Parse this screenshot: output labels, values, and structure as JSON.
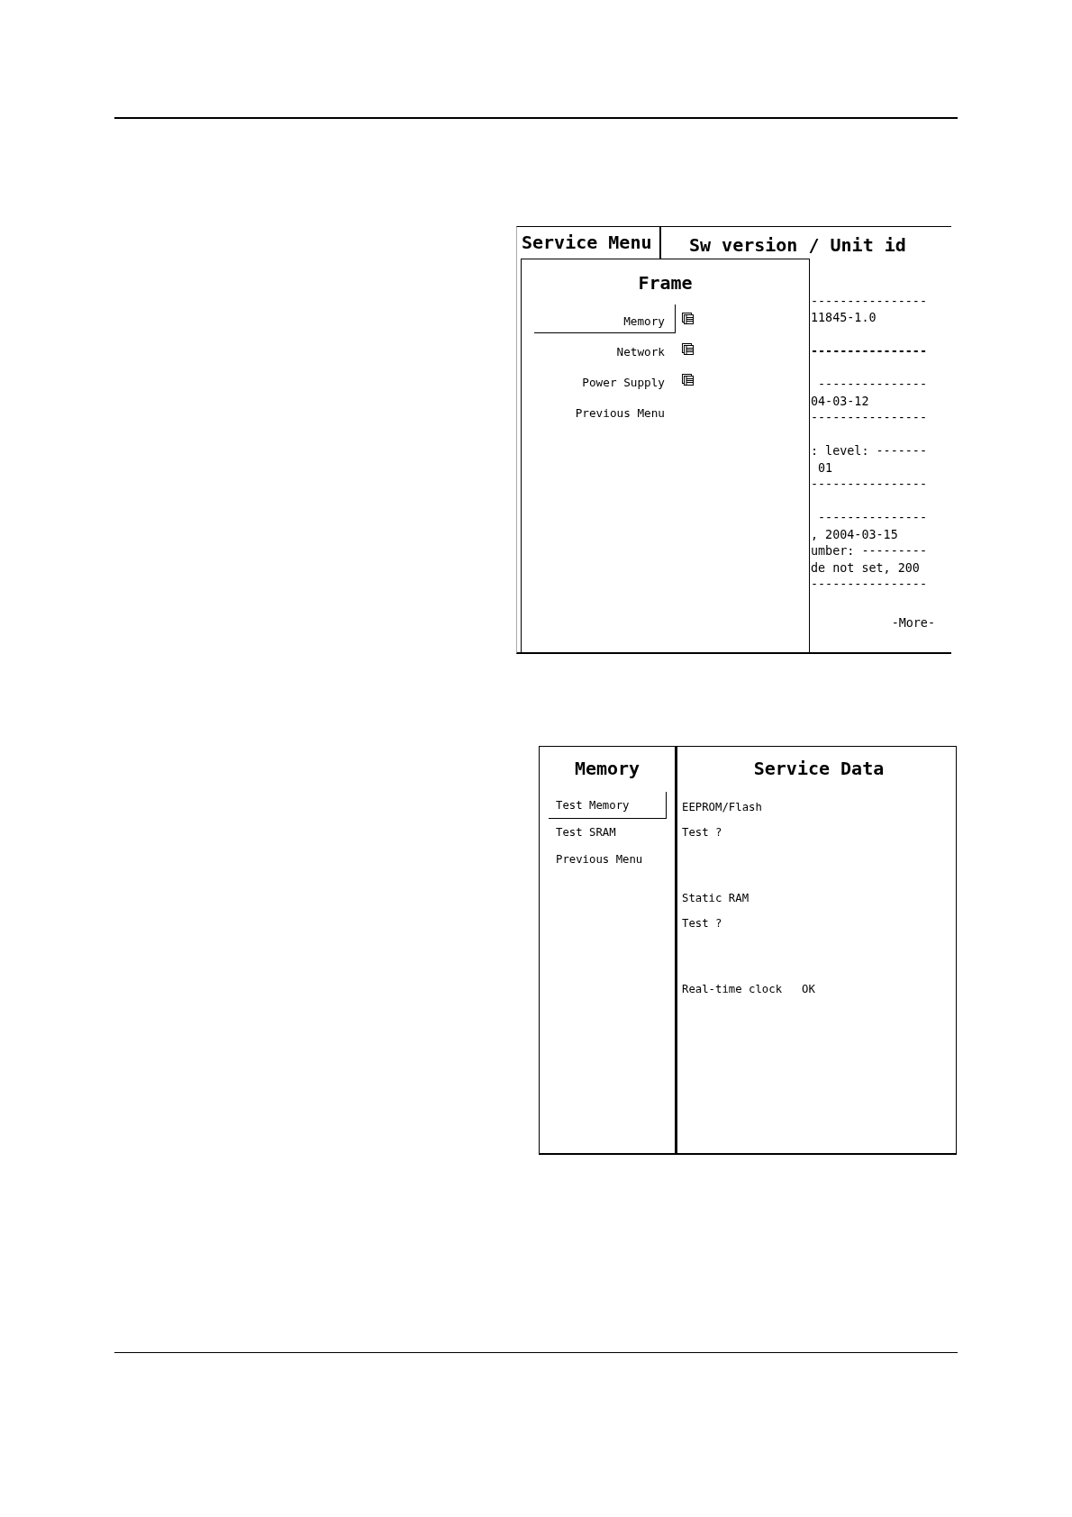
{
  "top_screen": {
    "menu_title": "Service Menu",
    "window_title": "Sw version / Unit id",
    "popup": {
      "title": "Frame",
      "items": [
        {
          "label": "Memory",
          "selected": true,
          "has_submenu": true
        },
        {
          "label": "Network",
          "selected": false,
          "has_submenu": true
        },
        {
          "label": "Power Supply",
          "selected": false,
          "has_submenu": true
        },
        {
          "label": "Previous Menu",
          "selected": false,
          "has_submenu": false
        }
      ]
    },
    "info_groups": [
      {
        "lines": [
          {
            "text": "----------------",
            "bold": false
          },
          {
            "text": "11845-1.0",
            "bold": false
          }
        ]
      },
      {
        "lines": [
          {
            "text": "----------------",
            "bold": true
          }
        ]
      },
      {
        "lines": [
          {
            "text": " ---------------",
            "bold": false
          },
          {
            "text": "04-03-12",
            "bold": false
          },
          {
            "text": "----------------",
            "bold": false
          }
        ]
      },
      {
        "lines": [
          {
            "text": ": level: -------",
            "bold": false
          },
          {
            "text": " 01",
            "bold": false
          },
          {
            "text": "----------------",
            "bold": false
          }
        ]
      },
      {
        "lines": [
          {
            "text": " ---------------",
            "bold": false
          },
          {
            "text": ", 2004-03-15",
            "bold": false
          },
          {
            "text": "umber: ---------",
            "bold": false
          },
          {
            "text": "de not set, 200",
            "bold": false
          },
          {
            "text": "----------------",
            "bold": false
          }
        ]
      }
    ],
    "more": "-More-"
  },
  "bottom_screen": {
    "menu": {
      "title": "Memory",
      "items": [
        {
          "label": "Test Memory",
          "selected": true
        },
        {
          "label": "Test SRAM",
          "selected": false
        },
        {
          "label": "Previous Menu",
          "selected": false
        }
      ]
    },
    "data": {
      "title": "Service Data",
      "sections": [
        {
          "heading": "EEPROM/Flash",
          "prompt": "Test ?"
        },
        {
          "heading": "Static RAM",
          "prompt": "Test ?"
        },
        {
          "heading": "Real-time clock",
          "status": "OK"
        }
      ]
    }
  }
}
